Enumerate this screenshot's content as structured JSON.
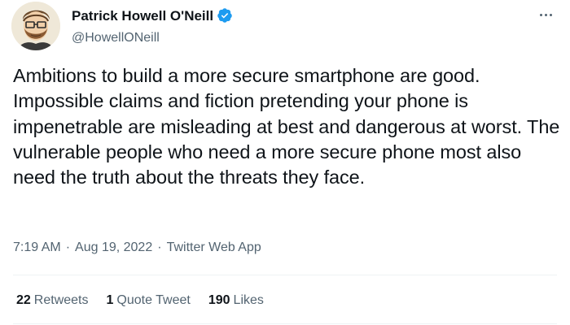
{
  "author": {
    "display_name": "Patrick Howell O'Neill",
    "handle": "@HowellONeill",
    "verified_icon": "verified-badge-icon"
  },
  "tweet": {
    "text": "Ambitions to build a more secure smartphone are good. Impossible claims and fiction pretending your phone is impenetrable are misleading at best and dangerous at worst. The vulnerable people who need a more secure phone most also need the truth about the threats they face.",
    "time": "7:19 AM",
    "date": "Aug 19, 2022",
    "separator": "·",
    "source": "Twitter Web App"
  },
  "stats": {
    "retweets": {
      "count": "22",
      "label": "Retweets"
    },
    "quotes": {
      "count": "1",
      "label": "Quote Tweet"
    },
    "likes": {
      "count": "190",
      "label": "Likes"
    }
  },
  "colors": {
    "text_primary": "#0f1419",
    "text_secondary": "#536471",
    "verified_blue": "#1d9bf0",
    "divider": "#eff3f4"
  }
}
